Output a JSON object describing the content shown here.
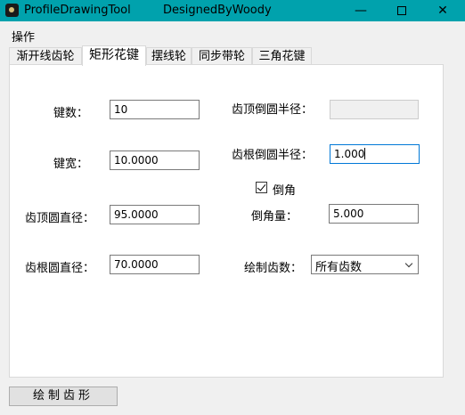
{
  "window": {
    "title": "ProfileDrawingTool",
    "subtitle": "DesignedByWoody",
    "minimize_symbol": "—",
    "close_symbol": "✕"
  },
  "menu": {
    "items": [
      "操作"
    ]
  },
  "tabs": [
    {
      "label": "渐开线齿轮",
      "active": false
    },
    {
      "label": "矩形花键",
      "active": true
    },
    {
      "label": "摆线轮",
      "active": false
    },
    {
      "label": "同步带轮",
      "active": false
    },
    {
      "label": "三角花键",
      "active": false
    }
  ],
  "form": {
    "key_count": {
      "label": "键数：",
      "value": "10"
    },
    "key_width": {
      "label": "键宽：",
      "value": "10.0000"
    },
    "tip_diameter": {
      "label": "齿顶圆直径：",
      "value": "95.0000"
    },
    "root_diameter": {
      "label": "齿根圆直径：",
      "value": "70.0000"
    },
    "tip_fillet_radius": {
      "label": "齿顶倒圆半径：",
      "value": ""
    },
    "root_fillet_radius": {
      "label": "齿根倒圆半径：",
      "value": "1.000"
    },
    "chamfer": {
      "label": "倒角",
      "checked": true
    },
    "chamfer_amount": {
      "label": "倒角量：",
      "value": "5.000"
    },
    "draw_teeth": {
      "label": "绘制齿数：",
      "selected": "所有齿数"
    }
  },
  "actions": {
    "draw_button": "绘制齿形"
  }
}
